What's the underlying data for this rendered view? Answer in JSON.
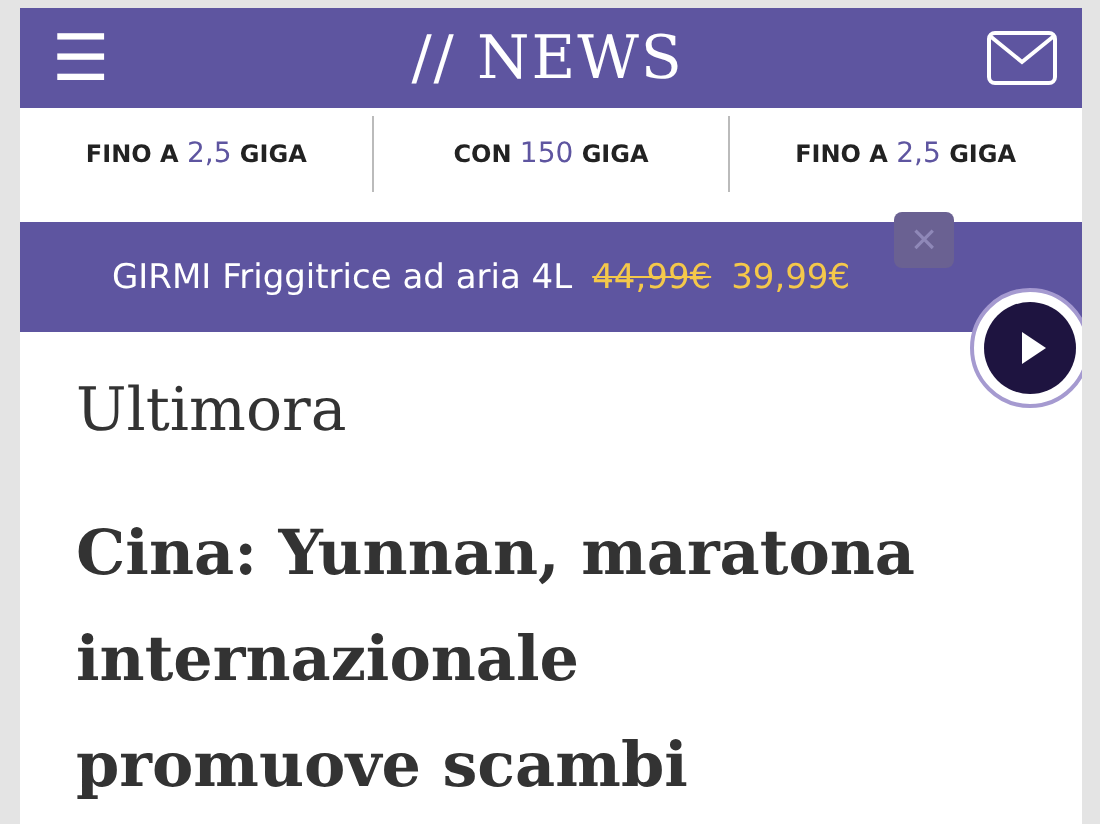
{
  "header": {
    "menu_icon": "☰",
    "logo": "// NEWS"
  },
  "offers": [
    {
      "prefix": "FINO A",
      "highlight": "2,5",
      "suffix": "GIGA"
    },
    {
      "prefix": "CON",
      "highlight": "150",
      "suffix": "GIGA"
    },
    {
      "prefix": "FINO A",
      "highlight": "2,5",
      "suffix": "GIGA"
    }
  ],
  "promo": {
    "product": "GIRMI Friggitrice ad aria 4L",
    "old_price": "44,99€",
    "new_price": "39,99€",
    "close": "×"
  },
  "section": "Ultimora",
  "headline": "Cina: Yunnan, maratona internazionale promuove scambi"
}
